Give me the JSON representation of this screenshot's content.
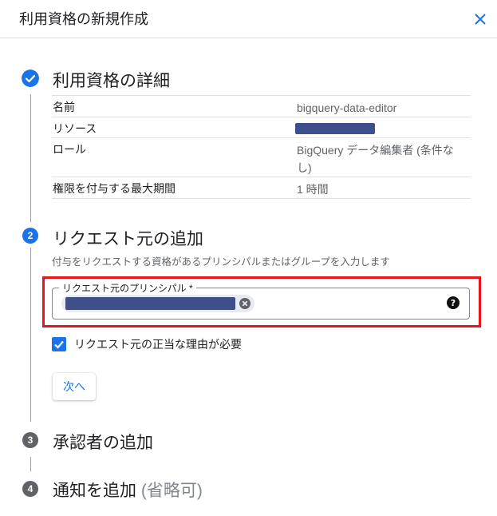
{
  "dialog": {
    "title": "利用資格の新規作成"
  },
  "step1": {
    "title": "利用資格の詳細",
    "rows": [
      {
        "key": "名前",
        "value": "bigquery-data-editor"
      },
      {
        "key": "リソース",
        "value": ""
      },
      {
        "key": "ロール",
        "value": "BigQuery データ編集者 (条件なし)"
      },
      {
        "key": "権限を付与する最大期間",
        "value": "1 時間"
      }
    ]
  },
  "step2": {
    "number": "2",
    "title": "リクエスト元の追加",
    "description": "付与をリクエストする資格があるプリンシパルまたはグループを入力します",
    "field_label": "リクエスト元のプリンシパル *",
    "checkbox_label": "リクエスト元の正当な理由が必要",
    "checkbox_checked": true,
    "next_label": "次へ"
  },
  "step3": {
    "number": "3",
    "title": "承認者の追加"
  },
  "step4": {
    "number": "4",
    "title": "通知を追加",
    "optional": "(省略可)"
  },
  "colors": {
    "accent": "#1a73e8",
    "highlight": "#e8121f",
    "redaction": "#3f4f8c"
  }
}
